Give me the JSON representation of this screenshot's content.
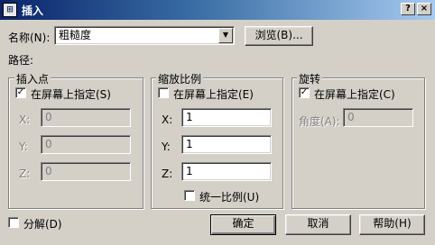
{
  "window": {
    "title": "插入",
    "icon_glyph": "⊞",
    "help_button": "?",
    "close_button": "×"
  },
  "name_row": {
    "label": "名称(N):",
    "value": "粗糙度",
    "dropdown_arrow": "▼",
    "browse_label": "浏览(B)..."
  },
  "path": {
    "label": "路径:"
  },
  "insertion_point": {
    "title": "插入点",
    "specify_label": "在屏幕上指定(S)",
    "specify_checked": true,
    "x_label": "X:",
    "x_value": "0",
    "y_label": "Y:",
    "y_value": "0",
    "z_label": "Z:",
    "z_value": "0"
  },
  "scale": {
    "title": "缩放比例",
    "specify_label": "在屏幕上指定(E)",
    "specify_checked": false,
    "x_label": "X:",
    "x_value": "1",
    "y_label": "Y:",
    "y_value": "1",
    "z_label": "Z:",
    "z_value": "1",
    "uniform_label": "统一比例(U)",
    "uniform_checked": false
  },
  "rotation": {
    "title": "旋转",
    "specify_label": "在屏幕上指定(C)",
    "specify_checked": true,
    "angle_label": "角度(A):",
    "angle_value": "0"
  },
  "explode": {
    "label": "分解(D)",
    "checked": false
  },
  "buttons": {
    "ok": "确定",
    "cancel": "取消",
    "help": "帮助(H)"
  },
  "check_glyph": "✓"
}
